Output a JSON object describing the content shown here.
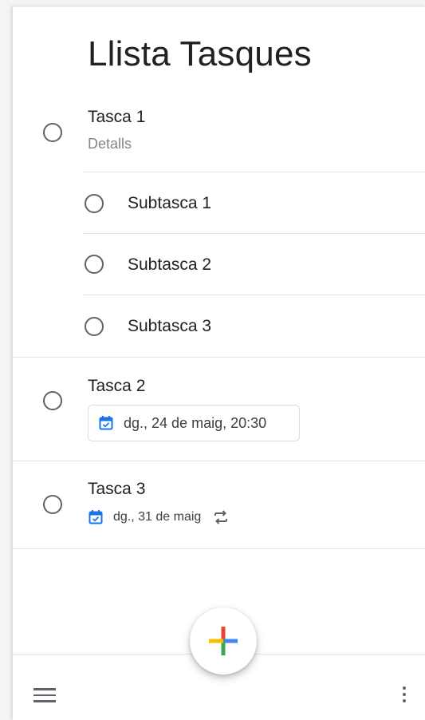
{
  "list": {
    "title": "Llista Tasques"
  },
  "tasks": [
    {
      "title": "Tasca 1",
      "details": "Detalls",
      "subtasks": [
        {
          "title": "Subtasca 1"
        },
        {
          "title": "Subtasca 2"
        },
        {
          "title": "Subtasca 3"
        }
      ]
    },
    {
      "title": "Tasca 2",
      "date": "dg., 24 de maig, 20:30"
    },
    {
      "title": "Tasca 3",
      "date": "dg., 31 de maig",
      "repeat": true
    }
  ],
  "icons": {
    "checkbox": "circle-outline-icon",
    "calendar": "calendar-check-icon",
    "repeat": "repeat-icon",
    "menu": "hamburger-menu-icon",
    "more": "more-vert-icon",
    "add": "google-plus-icon"
  },
  "colors": {
    "calendar_blue": "#1a73e8",
    "add_blue": "#4285f4",
    "add_red": "#ea4335",
    "add_yellow": "#fbbc04",
    "add_green": "#34a853"
  }
}
